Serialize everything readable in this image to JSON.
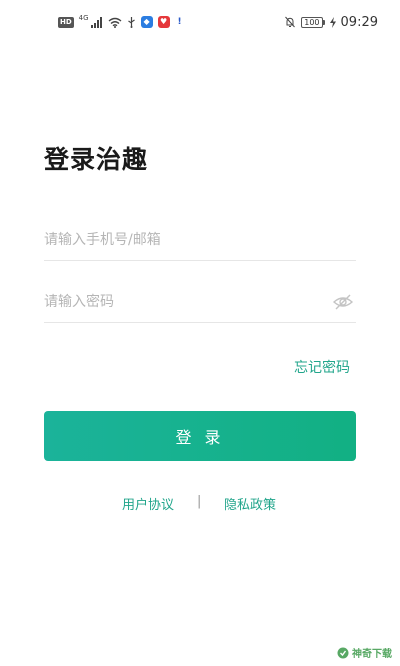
{
  "status_bar": {
    "hd": "HD",
    "network": "4G",
    "battery": "100",
    "time": "09:29",
    "colors": {
      "app_badge_blue": "#2b7de1",
      "app_badge_red": "#e5383b"
    }
  },
  "page": {
    "title": "登录治趣"
  },
  "form": {
    "account_placeholder": "请输入手机号/邮箱",
    "account_value": "",
    "password_placeholder": "请输入密码",
    "password_value": "",
    "forgot_password": "忘记密码",
    "login_button": "登 录"
  },
  "footer": {
    "user_agreement": "用户协议",
    "divider": "|",
    "privacy_policy": "隐私政策"
  },
  "watermark": {
    "text": "神奇下载"
  },
  "theme": {
    "accent": "#1bb39a",
    "link": "#21a58b"
  }
}
